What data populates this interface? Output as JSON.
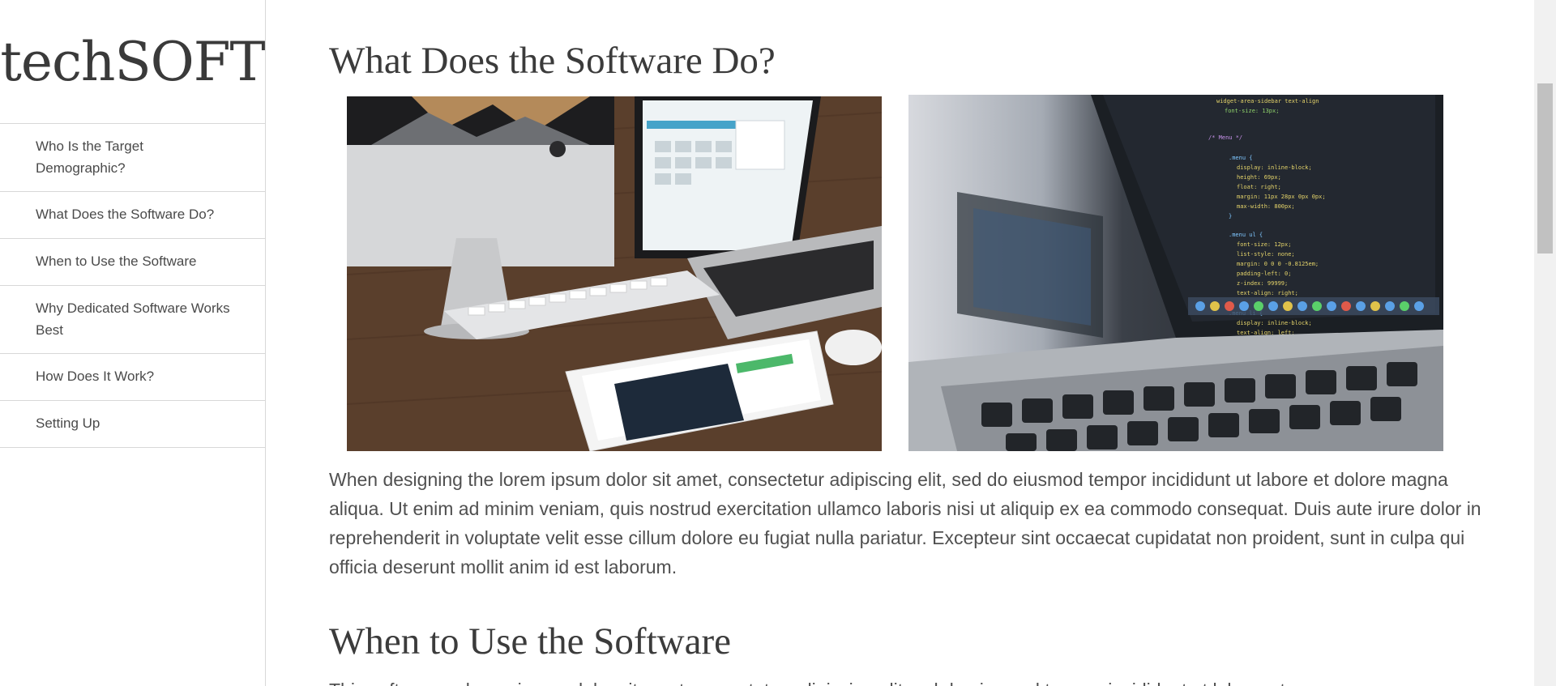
{
  "sidebar": {
    "logo": "techSOFT",
    "items": [
      {
        "label": "Who Is the Target Demographic?"
      },
      {
        "label": "What Does the Software Do?"
      },
      {
        "label": "When to Use the Software"
      },
      {
        "label": "Why Dedicated Software Works Best"
      },
      {
        "label": "How Does It Work?"
      },
      {
        "label": "Setting Up"
      }
    ]
  },
  "main": {
    "section1": {
      "title": "What Does the Software Do?",
      "paragraph": "When designing the lorem ipsum dolor sit amet, consectetur adipiscing elit, sed do eiusmod tempor incididunt ut labore et dolore magna aliqua. Ut enim ad minim veniam, quis nostrud exercitation ullamco laboris nisi ut aliquip ex ea commodo consequat. Duis aute irure dolor in reprehenderit in voluptate velit esse cillum dolore eu fugiat nulla pariatur. Excepteur sint occaecat cupidatat non proident, sunt in culpa qui officia deserunt mollit anim id est laborum."
    },
    "section2": {
      "title": "When to Use the Software",
      "paragraph": "This software ... lorem ipsum dolor sit amet consectetur adipiscing elit sed do eiusmod tempor incididunt ut labore et"
    }
  },
  "colors": {
    "text": "#505050",
    "heading": "#3b3b3b",
    "border": "#d8d8d8"
  }
}
